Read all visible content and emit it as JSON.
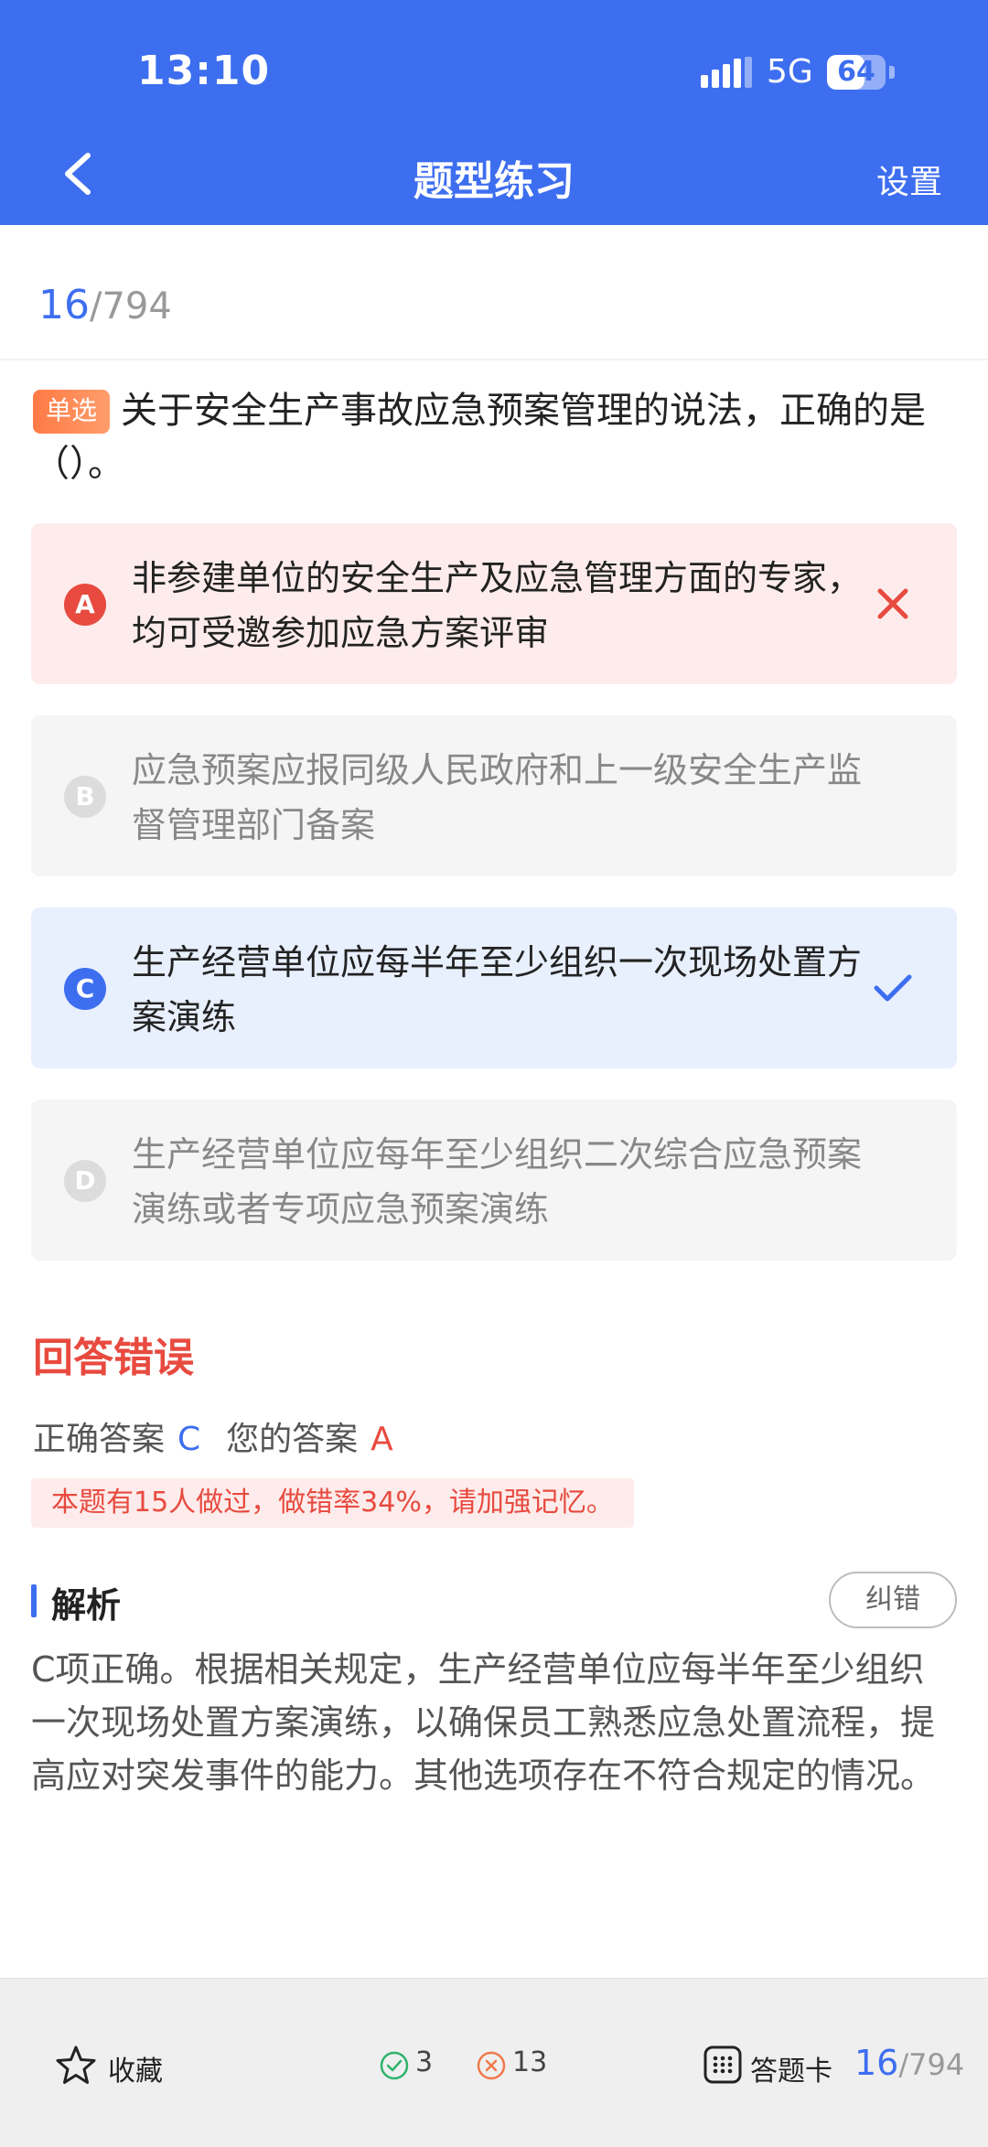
{
  "status": {
    "time": "13:10",
    "network": "5G",
    "battery": "64",
    "battery_level": 0.64
  },
  "header": {
    "title": "题型练习",
    "settings": "设置"
  },
  "progress": {
    "current": "16",
    "total": "/794"
  },
  "question": {
    "type_tag": "单选",
    "text": "关于安全生产事故应急预案管理的说法，正确的是（）。"
  },
  "options": [
    {
      "letter": "A",
      "text": "非参建单位的安全生产及应急管理方面的专家，均可受邀参加应急方案评审",
      "state": "wrong"
    },
    {
      "letter": "B",
      "text": "应急预案应报同级人民政府和上一级安全生产监督管理部门备案",
      "state": "neutral"
    },
    {
      "letter": "C",
      "text": "生产经营单位应每半年至少组织一次现场处置方案演练",
      "state": "correct"
    },
    {
      "letter": "D",
      "text": "生产经营单位应每年至少组织二次综合应急预案演练或者专项应急预案演练",
      "state": "neutral"
    }
  ],
  "result": {
    "title": "回答错误",
    "correct_label": "正确答案",
    "correct_value": "C",
    "your_label": "您的答案",
    "your_value": "A",
    "stat_note": "本题有15人做过，做错率34%，请加强记忆。"
  },
  "analysis": {
    "title": "解析",
    "fix_button": "纠错",
    "text": "C项正确。根据相关规定，生产经营单位应每半年至少组织一次现场处置方案演练，以确保员工熟悉应急处置流程，提高应对突发事件的能力。其他选项存在不符合规定的情况。"
  },
  "bottom_bar": {
    "favorite": "收藏",
    "correct_count": "3",
    "wrong_count": "13",
    "answer_card": "答题卡",
    "current": "16",
    "total": "/794"
  },
  "colors": {
    "primary": "#3d6ef0",
    "error": "#e84a3f",
    "correct_green": "#2fb36b",
    "wrong_orange": "#f07a4a"
  },
  "icons": [
    "back-arrow-icon",
    "signal-icon",
    "battery-icon",
    "close-icon",
    "check-icon",
    "star-icon",
    "check-circle-icon",
    "x-circle-icon",
    "grid-icon"
  ]
}
